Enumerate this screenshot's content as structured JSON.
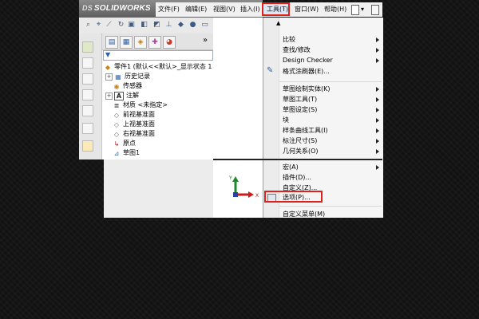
{
  "app": {
    "brand": "SOLIDWORKS",
    "brand_prefix": "DS"
  },
  "menubar": {
    "items": [
      {
        "label": "文件(F)"
      },
      {
        "label": "编辑(E)"
      },
      {
        "label": "视图(V)"
      },
      {
        "label": "插入(I)"
      },
      {
        "label": "工具(T)"
      },
      {
        "label": "窗口(W)"
      },
      {
        "label": "帮助(H)"
      }
    ]
  },
  "feature_manager": {
    "collapse_label": "»",
    "filter_icon": "funnel-icon",
    "tree": [
      {
        "label": "零件1 (默认<<默认>_显示状态 1",
        "icon": "part-icon"
      },
      {
        "label": "历史记录",
        "icon": "history-icon"
      },
      {
        "label": "传感器",
        "icon": "sensor-icon"
      },
      {
        "label": "注解",
        "icon": "annotation-icon"
      },
      {
        "label": "材质 <未指定>",
        "icon": "material-icon"
      },
      {
        "label": "前视基准面",
        "icon": "plane-icon"
      },
      {
        "label": "上视基准面",
        "icon": "plane-icon"
      },
      {
        "label": "右视基准面",
        "icon": "plane-icon"
      },
      {
        "label": "原点",
        "icon": "origin-icon"
      },
      {
        "label": "草图1",
        "icon": "sketch-icon"
      }
    ]
  },
  "triad": {
    "x_label": "X",
    "y_label": "Y"
  },
  "tools_menu": {
    "scroll_up": "▲",
    "items": [
      {
        "label": "比较",
        "submenu": true
      },
      {
        "label": "查找/修改",
        "submenu": true
      },
      {
        "label": "Design Checker",
        "submenu": true
      },
      {
        "label": "格式涂刷器(E)...",
        "submenu": false
      },
      {
        "label": "草图绘制实体(K)",
        "submenu": true
      },
      {
        "label": "草图工具(T)",
        "submenu": true
      },
      {
        "label": "草图设定(S)",
        "submenu": true
      },
      {
        "label": "块",
        "submenu": true
      },
      {
        "label": "样条曲线工具(I)",
        "submenu": true
      },
      {
        "label": "标注尺寸(S)",
        "submenu": true
      },
      {
        "label": "几何关系(O)",
        "submenu": true
      },
      {
        "label": "宏(A)",
        "submenu": true
      },
      {
        "label": "插件(D)...",
        "submenu": false
      },
      {
        "label": "自定义(Z)...",
        "submenu": false
      },
      {
        "label": "选项(P)...",
        "submenu": false
      },
      {
        "label": "自定义菜单(M)",
        "submenu": false
      }
    ]
  },
  "colors": {
    "highlight": "#e0201a",
    "accent": "#2b5fa8"
  }
}
